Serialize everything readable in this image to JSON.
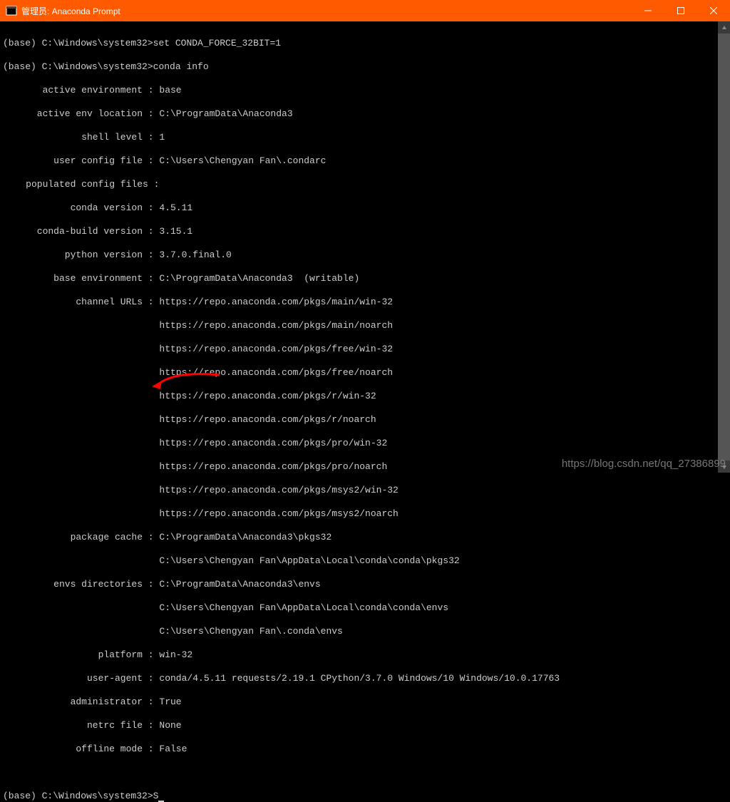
{
  "window": {
    "title": "管理员: Anaconda Prompt"
  },
  "prompt": {
    "base": "(base) C:\\Windows\\system32>",
    "cmd1": "set CONDA_FORCE_32BIT=1",
    "cmd2": "conda info",
    "cmd3": "S"
  },
  "info": {
    "labels": {
      "active_env": "active environment",
      "active_env_loc": "active env location",
      "shell_level": "shell level",
      "user_config": "user config file",
      "populated": "populated config files",
      "conda_version": "conda version",
      "conda_build": "conda-build version",
      "python_version": "python version",
      "base_env": "base environment",
      "channel_urls": "channel URLs",
      "package_cache": "package cache",
      "envs_dirs": "envs directories",
      "platform": "platform",
      "user_agent": "user-agent",
      "administrator": "administrator",
      "netrc": "netrc file",
      "offline": "offline mode"
    },
    "values": {
      "active_env": "base",
      "active_env_loc": "C:\\ProgramData\\Anaconda3",
      "shell_level": "1",
      "user_config": "C:\\Users\\Chengyan Fan\\.condarc",
      "populated": "",
      "conda_version": "4.5.11",
      "conda_build": "3.15.1",
      "python_version": "3.7.0.final.0",
      "base_env": "C:\\ProgramData\\Anaconda3  (writable)",
      "channel_urls": [
        "https://repo.anaconda.com/pkgs/main/win-32",
        "https://repo.anaconda.com/pkgs/main/noarch",
        "https://repo.anaconda.com/pkgs/free/win-32",
        "https://repo.anaconda.com/pkgs/free/noarch",
        "https://repo.anaconda.com/pkgs/r/win-32",
        "https://repo.anaconda.com/pkgs/r/noarch",
        "https://repo.anaconda.com/pkgs/pro/win-32",
        "https://repo.anaconda.com/pkgs/pro/noarch",
        "https://repo.anaconda.com/pkgs/msys2/win-32",
        "https://repo.anaconda.com/pkgs/msys2/noarch"
      ],
      "package_cache": [
        "C:\\ProgramData\\Anaconda3\\pkgs32",
        "C:\\Users\\Chengyan Fan\\AppData\\Local\\conda\\conda\\pkgs32"
      ],
      "envs_dirs": [
        "C:\\ProgramData\\Anaconda3\\envs",
        "C:\\Users\\Chengyan Fan\\AppData\\Local\\conda\\conda\\envs",
        "C:\\Users\\Chengyan Fan\\.conda\\envs"
      ],
      "platform": "win-32",
      "user_agent": "conda/4.5.11 requests/2.19.1 CPython/3.7.0 Windows/10 Windows/10.0.17763",
      "administrator": "True",
      "netrc": "None",
      "offline": "False"
    }
  },
  "watermark": "https://blog.csdn.net/qq_27386899"
}
